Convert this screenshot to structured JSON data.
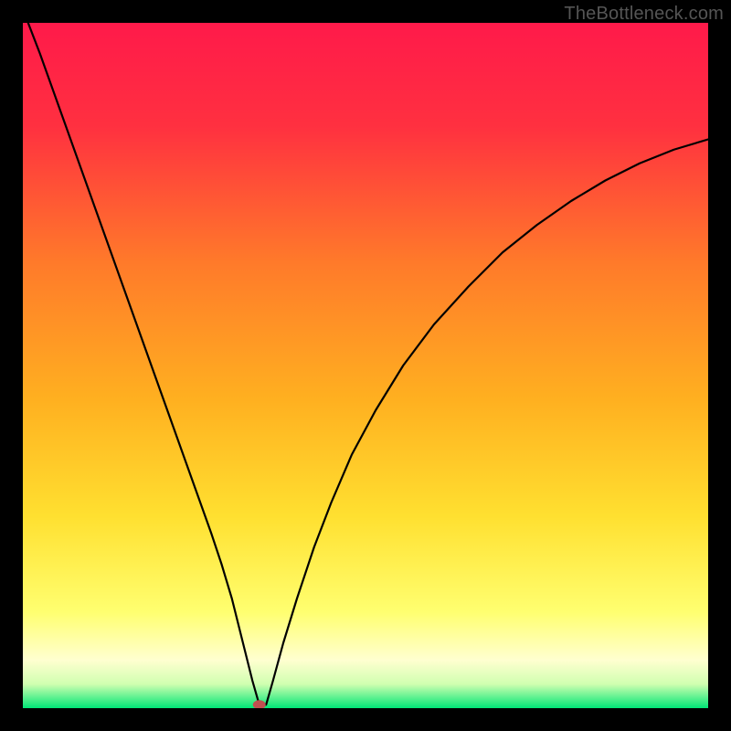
{
  "watermark": "TheBottleneck.com",
  "chart_data": {
    "type": "line",
    "title": "",
    "xlabel": "",
    "ylabel": "",
    "xlim": [
      0,
      1
    ],
    "ylim": [
      0,
      1
    ],
    "background_gradient": {
      "top": "#ff1744",
      "mid_upper": "#ff5722",
      "mid": "#ffc107",
      "mid_lower": "#ffeb3b",
      "lower": "#ffffa0",
      "bottom": "#00e676"
    },
    "marker": {
      "x": 0.345,
      "y": 0.005,
      "color": "#c05050"
    },
    "series": [
      {
        "name": "curve",
        "points": [
          {
            "x": 0.0,
            "y": 1.02
          },
          {
            "x": 0.025,
            "y": 0.955
          },
          {
            "x": 0.05,
            "y": 0.885
          },
          {
            "x": 0.075,
            "y": 0.815
          },
          {
            "x": 0.1,
            "y": 0.745
          },
          {
            "x": 0.125,
            "y": 0.675
          },
          {
            "x": 0.15,
            "y": 0.605
          },
          {
            "x": 0.175,
            "y": 0.535
          },
          {
            "x": 0.2,
            "y": 0.465
          },
          {
            "x": 0.225,
            "y": 0.395
          },
          {
            "x": 0.25,
            "y": 0.325
          },
          {
            "x": 0.275,
            "y": 0.255
          },
          {
            "x": 0.29,
            "y": 0.21
          },
          {
            "x": 0.305,
            "y": 0.16
          },
          {
            "x": 0.315,
            "y": 0.12
          },
          {
            "x": 0.325,
            "y": 0.08
          },
          {
            "x": 0.335,
            "y": 0.04
          },
          {
            "x": 0.345,
            "y": 0.005
          },
          {
            "x": 0.355,
            "y": 0.005
          },
          {
            "x": 0.365,
            "y": 0.04
          },
          {
            "x": 0.38,
            "y": 0.095
          },
          {
            "x": 0.4,
            "y": 0.16
          },
          {
            "x": 0.425,
            "y": 0.235
          },
          {
            "x": 0.45,
            "y": 0.3
          },
          {
            "x": 0.48,
            "y": 0.37
          },
          {
            "x": 0.515,
            "y": 0.435
          },
          {
            "x": 0.555,
            "y": 0.5
          },
          {
            "x": 0.6,
            "y": 0.56
          },
          {
            "x": 0.65,
            "y": 0.615
          },
          {
            "x": 0.7,
            "y": 0.665
          },
          {
            "x": 0.75,
            "y": 0.705
          },
          {
            "x": 0.8,
            "y": 0.74
          },
          {
            "x": 0.85,
            "y": 0.77
          },
          {
            "x": 0.9,
            "y": 0.795
          },
          {
            "x": 0.95,
            "y": 0.815
          },
          {
            "x": 1.0,
            "y": 0.83
          }
        ]
      }
    ]
  }
}
